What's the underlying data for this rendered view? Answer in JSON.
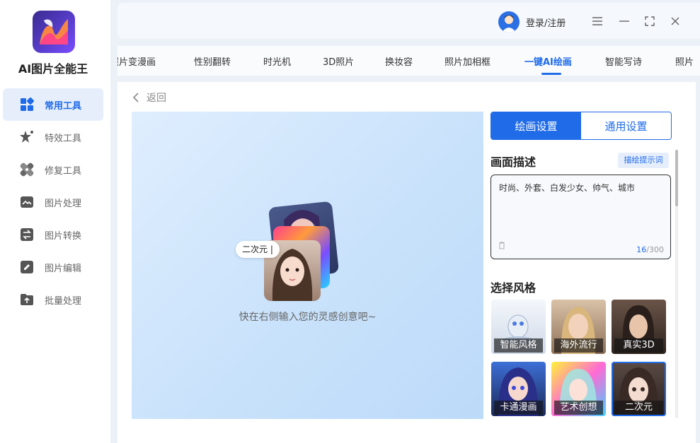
{
  "app": {
    "name": "AI图片全能王"
  },
  "sidebar": {
    "items": [
      {
        "label": "常用工具",
        "icon": "grid-icon",
        "active": true
      },
      {
        "label": "特效工具",
        "icon": "star-effect-icon",
        "active": false
      },
      {
        "label": "修复工具",
        "icon": "bandage-icon",
        "active": false
      },
      {
        "label": "图片处理",
        "icon": "image-icon",
        "active": false
      },
      {
        "label": "图片转换",
        "icon": "swap-icon",
        "active": false
      },
      {
        "label": "图片编辑",
        "icon": "edit-icon",
        "active": false
      },
      {
        "label": "批量处理",
        "icon": "upload-folder-icon",
        "active": false
      }
    ]
  },
  "header": {
    "login_label": "登录/注册"
  },
  "tabs": [
    {
      "label": "照片变漫画"
    },
    {
      "label": "性别翻转"
    },
    {
      "label": "时光机"
    },
    {
      "label": "3D照片"
    },
    {
      "label": "换妆容"
    },
    {
      "label": "照片加相框"
    },
    {
      "label": "一键AI绘画",
      "active": true
    },
    {
      "label": "智能写诗"
    },
    {
      "label": "照片"
    }
  ],
  "main": {
    "back_label": "返回",
    "canvas": {
      "chip_text": "二次元",
      "hint": "快在右侧输入您的灵感创意吧~"
    },
    "settings": {
      "tab_draw": "绘画设置",
      "tab_general": "通用设置",
      "description_title": "画面描述",
      "prompt_button": "描绘提示词",
      "description_value": "时尚、外套、白发少女、帅气、城市",
      "char_count": "16",
      "char_max": "/300",
      "style_title": "选择风格",
      "styles": [
        {
          "label": "智能风格"
        },
        {
          "label": "海外流行"
        },
        {
          "label": "真实3D"
        },
        {
          "label": "卡通漫画"
        },
        {
          "label": "艺术创想"
        },
        {
          "label": "二次元",
          "selected": true
        }
      ]
    }
  },
  "colors": {
    "accent": "#1f6be8",
    "sidebar_active_bg": "#e6eefc"
  }
}
